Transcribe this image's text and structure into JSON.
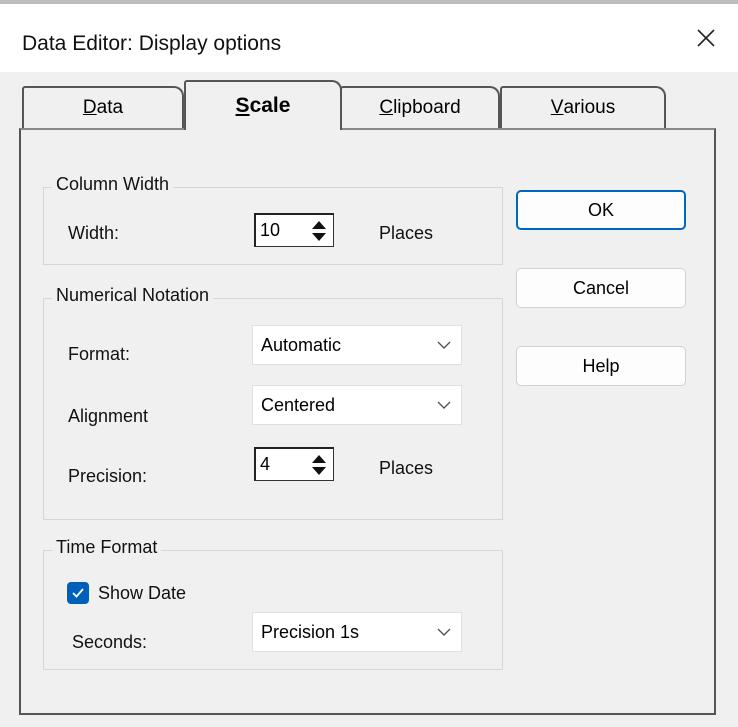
{
  "window": {
    "title": "Data Editor: Display options"
  },
  "tabs": [
    {
      "label": "Data",
      "mnemonic": "D",
      "rest": "ata",
      "active": false
    },
    {
      "label": "Scale",
      "mnemonic": "S",
      "rest": "cale",
      "active": true
    },
    {
      "label": "Clipboard",
      "mnemonic": "C",
      "rest": "lipboard",
      "active": false
    },
    {
      "label": "Various",
      "mnemonic": "V",
      "rest": "arious",
      "active": false
    }
  ],
  "column_width": {
    "group_label": "Column Width",
    "width_label": "Width:",
    "width_value": "10",
    "unit": "Places"
  },
  "numerical_notation": {
    "group_label": "Numerical Notation",
    "format_label": "Format:",
    "format_value": "Automatic",
    "alignment_label": "Alignment",
    "alignment_value": "Centered",
    "precision_label": "Precision:",
    "precision_value": "4",
    "unit": "Places"
  },
  "time_format": {
    "group_label": "Time Format",
    "show_date_label": "Show Date",
    "show_date_checked": true,
    "seconds_label": "Seconds:",
    "seconds_value": "Precision 1s"
  },
  "buttons": {
    "ok": "OK",
    "cancel": "Cancel",
    "help": "Help"
  },
  "colors": {
    "accent": "#005fb8",
    "default_button_border": "#0067c0"
  }
}
